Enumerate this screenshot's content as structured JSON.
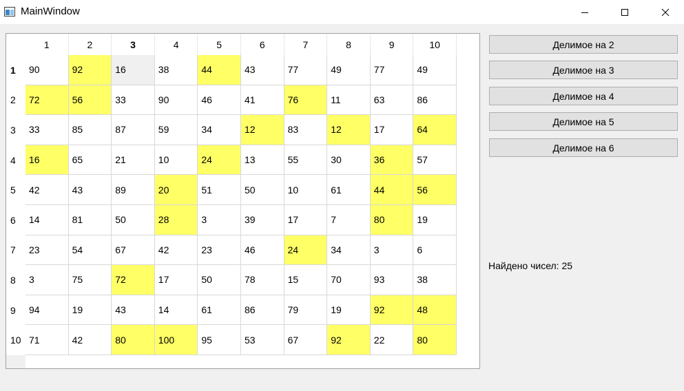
{
  "window": {
    "title": "MainWindow"
  },
  "colors": {
    "highlight": "#ffff66",
    "selected": "#f0f0f0"
  },
  "table": {
    "column_headers": [
      "1",
      "2",
      "3",
      "4",
      "5",
      "6",
      "7",
      "8",
      "9",
      "10"
    ],
    "row_headers": [
      "1",
      "2",
      "3",
      "4",
      "5",
      "6",
      "7",
      "8",
      "9",
      "10"
    ],
    "active_column": 2,
    "active_row": 0,
    "selected_cell": [
      0,
      2
    ],
    "rows": [
      [
        "90",
        "92",
        "16",
        "38",
        "44",
        "43",
        "77",
        "49",
        "77",
        "49"
      ],
      [
        "72",
        "56",
        "33",
        "90",
        "46",
        "41",
        "76",
        "11",
        "63",
        "86"
      ],
      [
        "33",
        "85",
        "87",
        "59",
        "34",
        "12",
        "83",
        "12",
        "17",
        "64"
      ],
      [
        "16",
        "65",
        "21",
        "10",
        "24",
        "13",
        "55",
        "30",
        "36",
        "57"
      ],
      [
        "42",
        "43",
        "89",
        "20",
        "51",
        "50",
        "10",
        "61",
        "44",
        "56"
      ],
      [
        "14",
        "81",
        "50",
        "28",
        "3",
        "39",
        "17",
        "7",
        "80",
        "19"
      ],
      [
        "23",
        "54",
        "67",
        "42",
        "23",
        "46",
        "24",
        "34",
        "3",
        "6"
      ],
      [
        "3",
        "75",
        "72",
        "17",
        "50",
        "78",
        "15",
        "70",
        "93",
        "38"
      ],
      [
        "94",
        "19",
        "43",
        "14",
        "61",
        "86",
        "79",
        "19",
        "92",
        "48"
      ],
      [
        "71",
        "42",
        "80",
        "100",
        "95",
        "53",
        "67",
        "92",
        "22",
        "80"
      ]
    ],
    "highlighted": [
      [
        0,
        1
      ],
      [
        0,
        4
      ],
      [
        1,
        0
      ],
      [
        1,
        1
      ],
      [
        1,
        6
      ],
      [
        2,
        5
      ],
      [
        2,
        7
      ],
      [
        2,
        9
      ],
      [
        3,
        0
      ],
      [
        3,
        4
      ],
      [
        3,
        8
      ],
      [
        4,
        3
      ],
      [
        4,
        8
      ],
      [
        4,
        9
      ],
      [
        5,
        3
      ],
      [
        5,
        8
      ],
      [
        6,
        6
      ],
      [
        7,
        2
      ],
      [
        8,
        8
      ],
      [
        8,
        9
      ],
      [
        9,
        2
      ],
      [
        9,
        3
      ],
      [
        9,
        7
      ],
      [
        9,
        9
      ]
    ]
  },
  "buttons": [
    {
      "label": "Делимое на 2"
    },
    {
      "label": "Делимое на 3"
    },
    {
      "label": "Делимое на 4"
    },
    {
      "label": "Делимое на 5"
    },
    {
      "label": "Делимое на 6"
    }
  ],
  "status": {
    "text": "Найдено чисел: 25"
  }
}
